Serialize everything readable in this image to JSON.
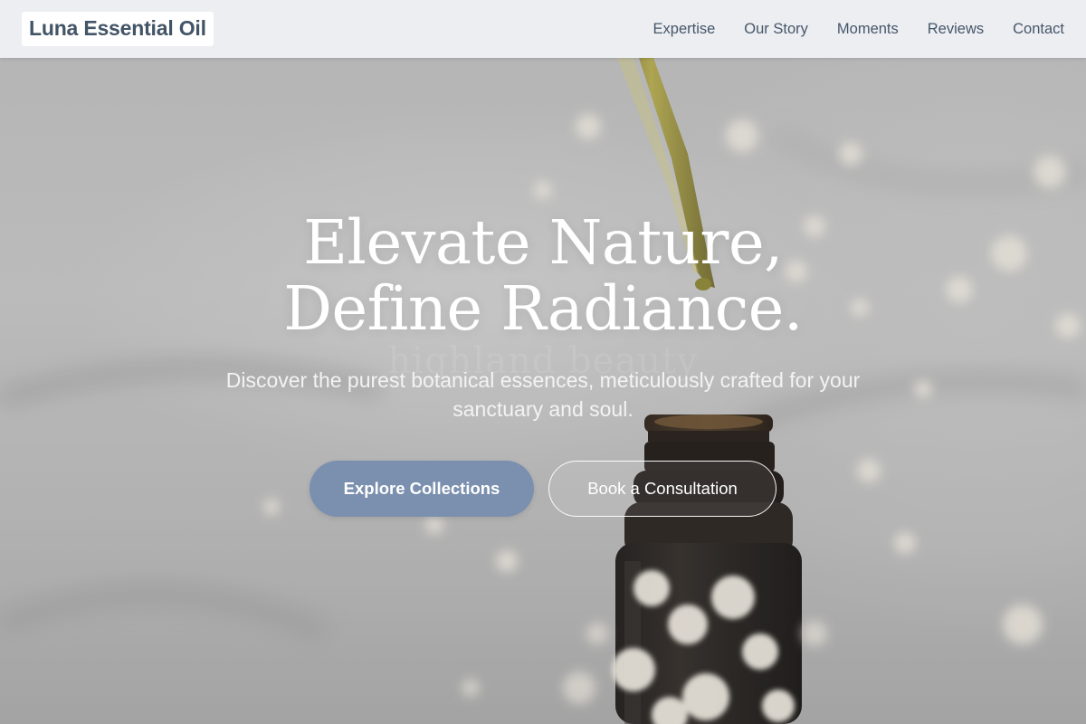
{
  "header": {
    "brand": "Luna Essential Oil",
    "nav": [
      "Expertise",
      "Our Story",
      "Moments",
      "Reviews",
      "Contact"
    ]
  },
  "hero": {
    "headline_line1": "Elevate Nature,",
    "headline_line2": "Define Radiance.",
    "faded_background_text": "highland beauty",
    "subtitle": "Discover the purest botanical essences, meticulously crafted for your sanctuary and soul.",
    "primary_cta": "Explore Collections",
    "secondary_cta": "Book a Consultation"
  },
  "colors": {
    "brand_text": "#425466",
    "nav_text": "#46566a",
    "primary_button": "#7b8faf",
    "header_bg": "#f0f2f5"
  },
  "icons": [
    "dropper-image",
    "bottle-image",
    "flowers-image"
  ]
}
